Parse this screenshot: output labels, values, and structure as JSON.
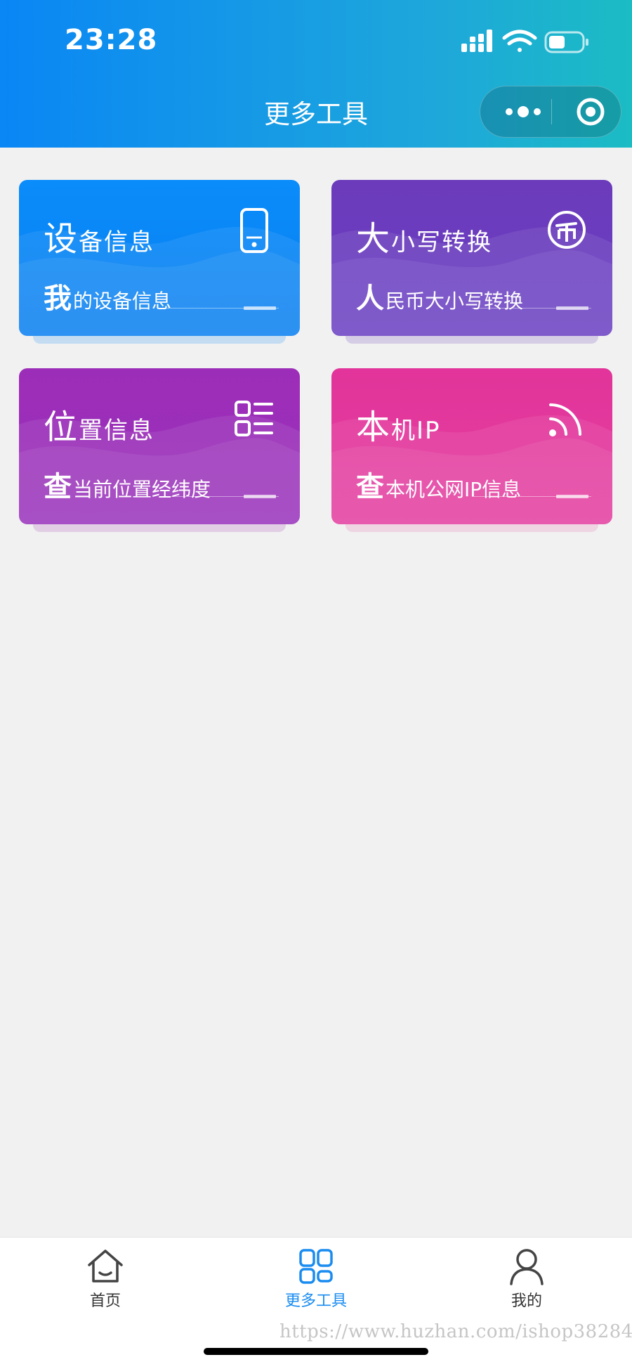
{
  "status": {
    "time": "23:28"
  },
  "nav": {
    "title": "更多工具"
  },
  "cards": [
    {
      "title_first": "设",
      "title_rest": "备信息",
      "sub_first": "我",
      "sub_rest": "的设备信息",
      "icon": "phone-icon"
    },
    {
      "title_first": "大",
      "title_rest": "小写转换",
      "sub_first": "人",
      "sub_rest": "民币大小写转换",
      "icon": "currency-icon"
    },
    {
      "title_first": "位",
      "title_rest": "置信息",
      "sub_first": "查",
      "sub_rest": "当前位置经纬度",
      "icon": "list-icon"
    },
    {
      "title_first": "本",
      "title_rest": "机IP",
      "sub_first": "查",
      "sub_rest": "本机公网IP信息",
      "icon": "rss-icon"
    }
  ],
  "tabbar": {
    "items": [
      {
        "label": "首页",
        "icon": "home-icon",
        "active": false
      },
      {
        "label": "更多工具",
        "icon": "grid-icon",
        "active": true
      },
      {
        "label": "我的",
        "icon": "user-icon",
        "active": false
      }
    ]
  },
  "watermark": "https://www.huzhan.com/ishop38284",
  "colors": {
    "header_start": "#0a86f5",
    "header_end": "#1bbcc4",
    "card_blue": "#0a8cfa",
    "card_purple": "#6b3bbb",
    "card_violet": "#9c2db8",
    "card_pink": "#e2349a",
    "tab_active": "#1a8cf0"
  }
}
